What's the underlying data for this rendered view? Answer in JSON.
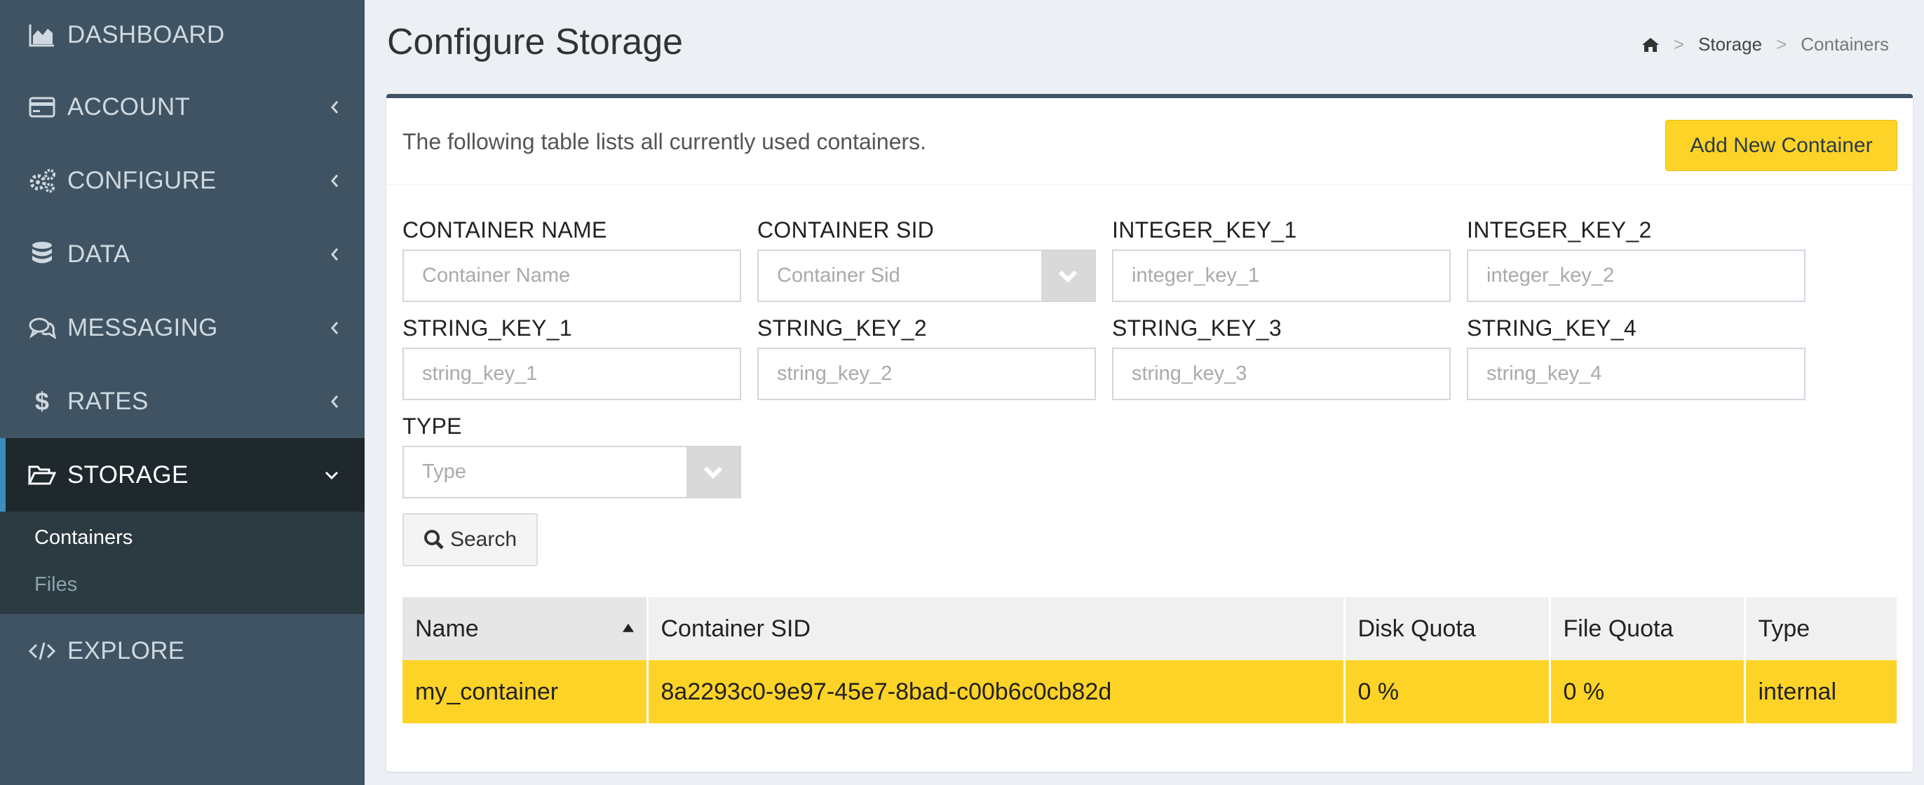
{
  "sidebar": {
    "items": [
      {
        "label": "DASHBOARD",
        "icon": "area-chart-icon"
      },
      {
        "label": "ACCOUNT",
        "icon": "credit-card-icon"
      },
      {
        "label": "CONFIGURE",
        "icon": "cogs-icon"
      },
      {
        "label": "DATA",
        "icon": "database-icon"
      },
      {
        "label": "MESSAGING",
        "icon": "comments-icon"
      },
      {
        "label": "RATES",
        "icon": "dollar-icon"
      },
      {
        "label": "STORAGE",
        "icon": "folder-open-icon"
      },
      {
        "label": "EXPLORE",
        "icon": "code-icon"
      }
    ],
    "storage_sub": [
      {
        "label": "Containers"
      },
      {
        "label": "Files"
      }
    ]
  },
  "header": {
    "title": "Configure Storage",
    "breadcrumb": [
      "Storage",
      "Containers"
    ]
  },
  "box": {
    "description": "The following table lists all currently used containers.",
    "add_button": "Add New Container"
  },
  "filters": {
    "container_name": {
      "label": "CONTAINER NAME",
      "placeholder": "Container Name"
    },
    "container_sid": {
      "label": "CONTAINER SID",
      "placeholder": "Container Sid"
    },
    "integer_key_1": {
      "label": "INTEGER_KEY_1",
      "placeholder": "integer_key_1"
    },
    "integer_key_2": {
      "label": "INTEGER_KEY_2",
      "placeholder": "integer_key_2"
    },
    "string_key_1": {
      "label": "STRING_KEY_1",
      "placeholder": "string_key_1"
    },
    "string_key_2": {
      "label": "STRING_KEY_2",
      "placeholder": "string_key_2"
    },
    "string_key_3": {
      "label": "STRING_KEY_3",
      "placeholder": "string_key_3"
    },
    "string_key_4": {
      "label": "STRING_KEY_4",
      "placeholder": "string_key_4"
    },
    "type": {
      "label": "TYPE",
      "placeholder": "Type"
    },
    "search_button": "Search"
  },
  "table": {
    "columns": [
      "Name",
      "Container SID",
      "Disk Quota",
      "File Quota",
      "Type"
    ],
    "rows": [
      [
        "my_container",
        "8a2293c0-9e97-45e7-8bad-c00b6c0cb82d",
        "0 %",
        "0 %",
        "internal"
      ]
    ]
  },
  "colors": {
    "sidebar_bg": "#3f5363",
    "accent_yellow": "#fdd327",
    "active_item_bg": "#1e282d"
  }
}
